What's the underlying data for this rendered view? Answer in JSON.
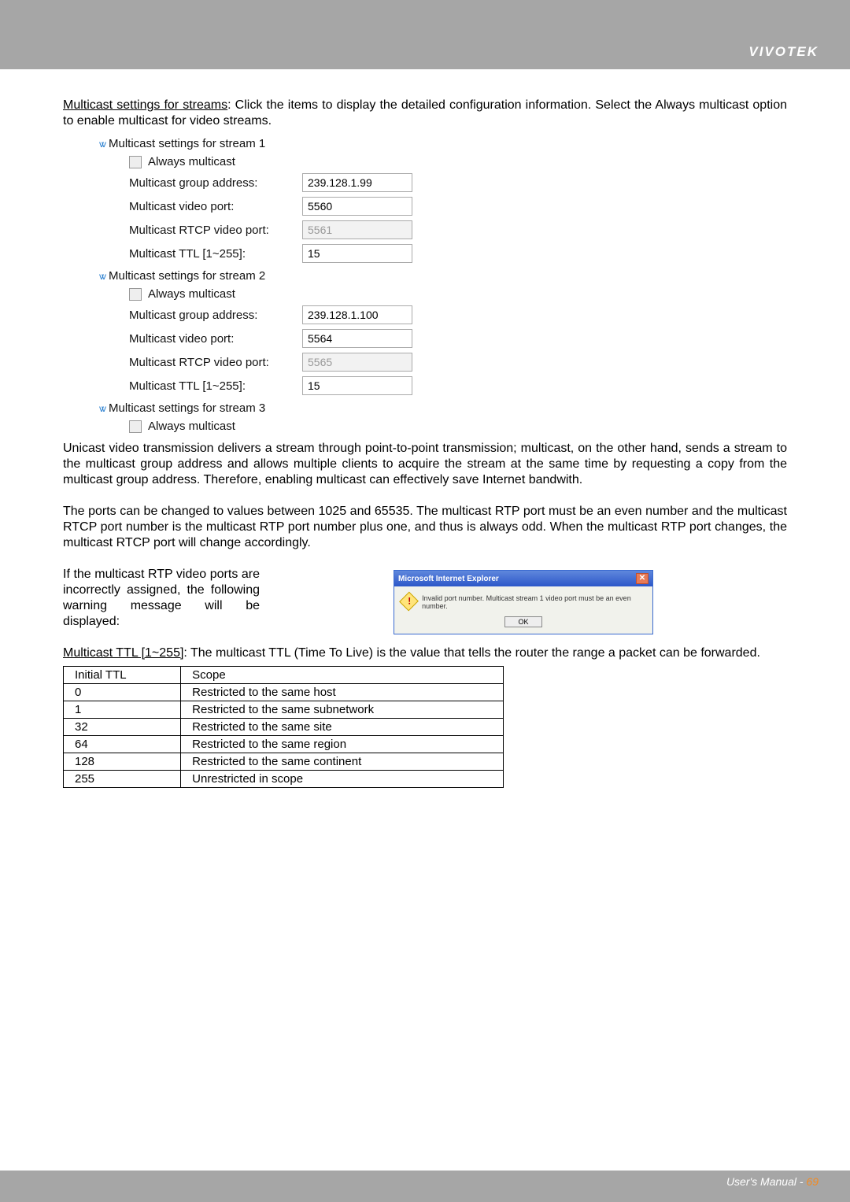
{
  "brand": "VIVOTEK",
  "intro_underline": "Multicast settings for streams",
  "intro_rest": ": Click the items to display the detailed configuration information. Select the Always multicast option to enable multicast for video streams.",
  "ui": {
    "streams": [
      {
        "title": "Multicast settings for stream 1",
        "always": "Always multicast",
        "fields": {
          "group_lbl": "Multicast group address:",
          "group_val": "239.128.1.99",
          "vport_lbl": "Multicast video port:",
          "vport_val": "5560",
          "rtcp_lbl": "Multicast RTCP video port:",
          "rtcp_val": "5561",
          "ttl_lbl": "Multicast TTL [1~255]:",
          "ttl_val": "15"
        }
      },
      {
        "title": "Multicast settings for stream 2",
        "always": "Always multicast",
        "fields": {
          "group_lbl": "Multicast group address:",
          "group_val": "239.128.1.100",
          "vport_lbl": "Multicast video port:",
          "vport_val": "5564",
          "rtcp_lbl": "Multicast RTCP video port:",
          "rtcp_val": "5565",
          "ttl_lbl": "Multicast TTL [1~255]:",
          "ttl_val": "15"
        }
      },
      {
        "title": "Multicast settings for stream 3",
        "always": "Always multicast"
      }
    ]
  },
  "para2": "Unicast video transmission delivers a stream through point-to-point transmission; multicast, on the other hand, sends a stream to the multicast group address and allows multiple clients to acquire the stream at the same time by requesting a copy from the multicast group address. Therefore, enabling multicast can effectively save Internet bandwith.",
  "para3": "The ports can be changed to values between 1025 and 65535. The multicast RTP port must be an even number and the multicast RTCP port number is the multicast RTP port number plus one, and thus is always odd. When the multicast RTP port changes, the multicast RTCP port will change accordingly.",
  "para4": "If the multicast RTP video ports are incorrectly assigned, the following warning message will be displayed:",
  "dialog": {
    "title": "Microsoft Internet Explorer",
    "msg": "Invalid port number. Multicast stream 1 video port must be an even number.",
    "ok": "OK"
  },
  "ttl_head_u": "Multicast TTL [1~255]",
  "ttl_head_rest": ": The multicast TTL (Time To Live) is the value that tells the router the range a packet can be forwarded.",
  "ttl_table": {
    "headers": [
      "Initial TTL",
      "Scope"
    ],
    "rows": [
      [
        "0",
        "Restricted to the same host"
      ],
      [
        "1",
        "Restricted to the same subnetwork"
      ],
      [
        "32",
        "Restricted to the same site"
      ],
      [
        "64",
        "Restricted to the same region"
      ],
      [
        "128",
        "Restricted to the same continent"
      ],
      [
        "255",
        "Unrestricted in scope"
      ]
    ]
  },
  "footer_text": "User's Manual - ",
  "footer_page": "69"
}
